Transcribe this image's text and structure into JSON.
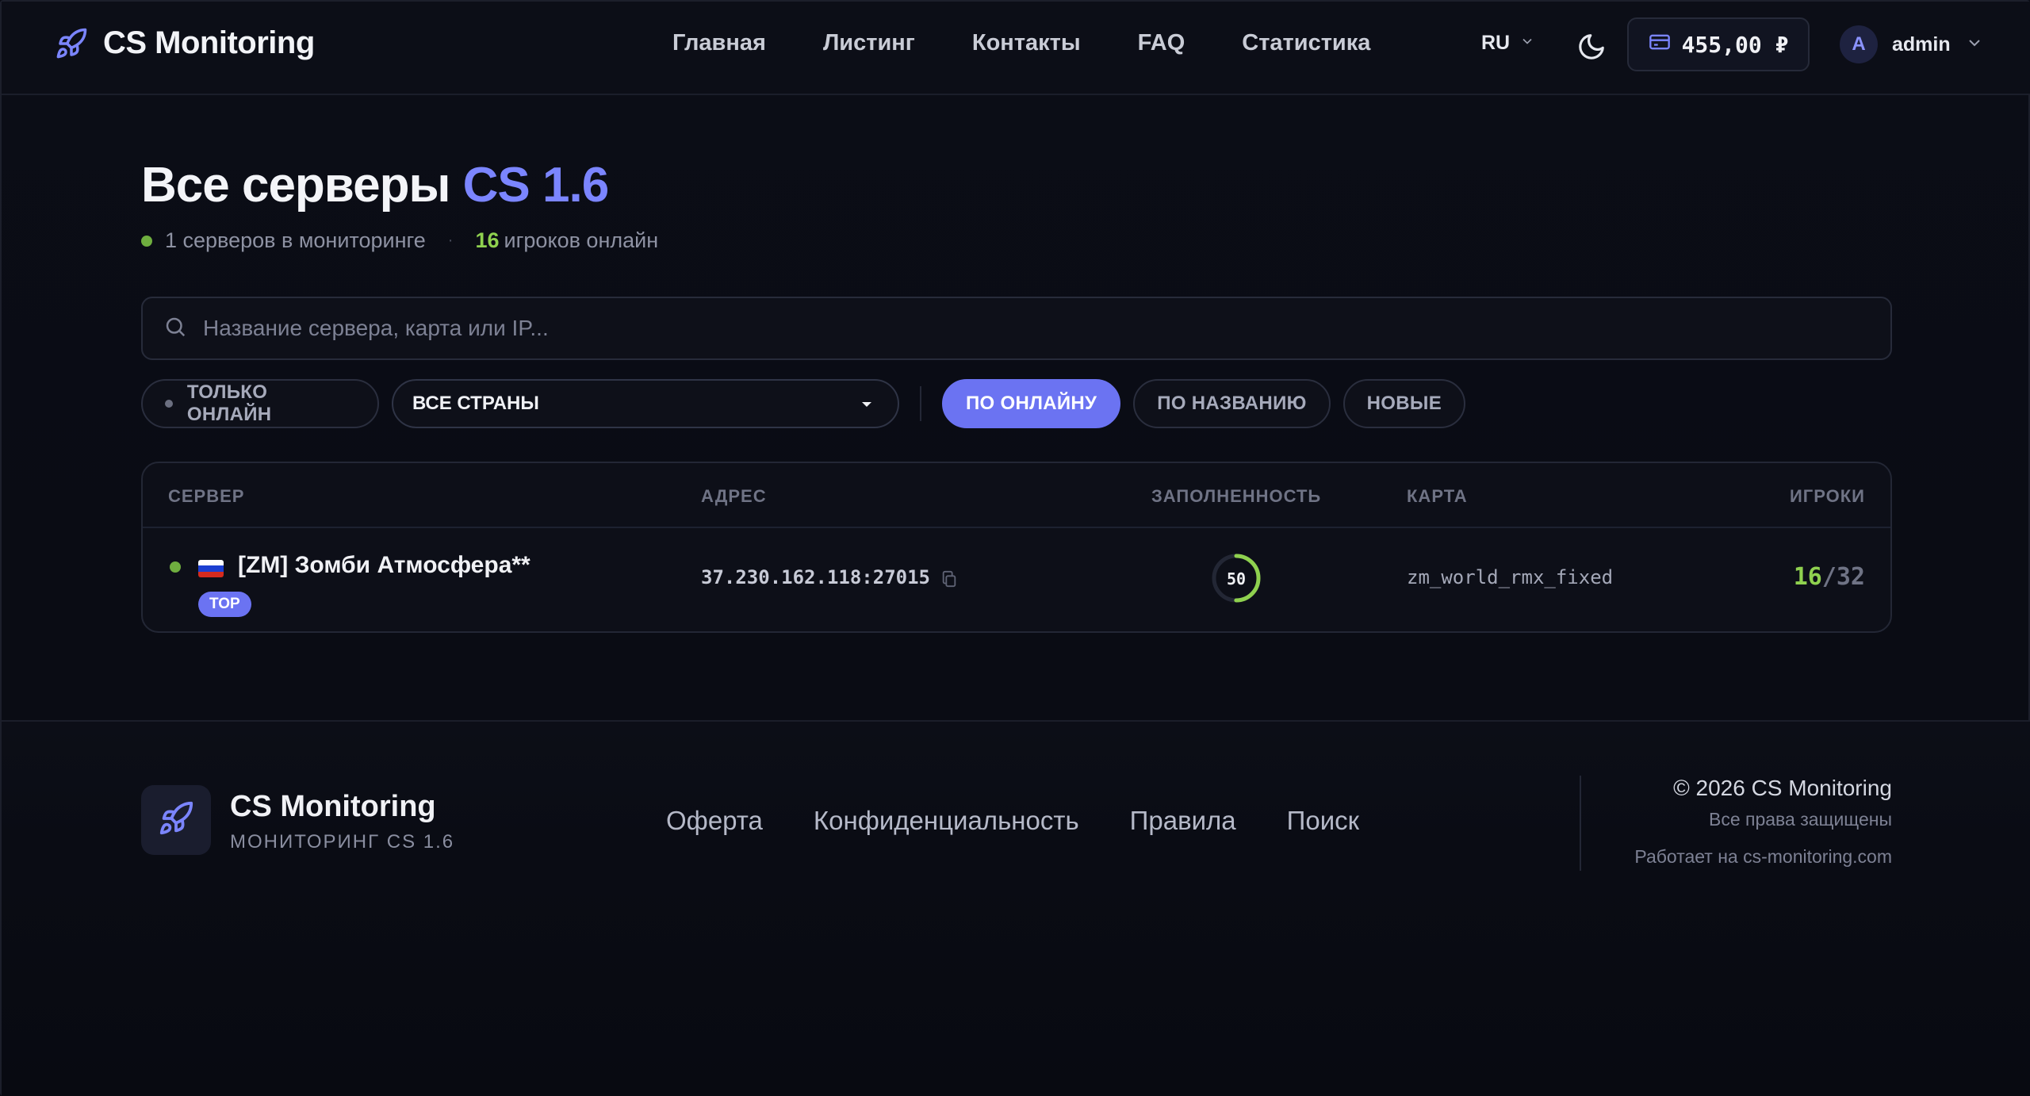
{
  "header": {
    "brand": "CS Monitoring",
    "nav": [
      "Главная",
      "Листинг",
      "Контакты",
      "FAQ",
      "Статистика"
    ],
    "lang": "RU",
    "balance": "455,00 ₽",
    "avatar_letter": "A",
    "username": "admin"
  },
  "main": {
    "title": "Все серверы",
    "title_accent": "CS 1.6",
    "servers_text": "1 серверов в мониторинге",
    "players_count": "16",
    "players_text": "игроков онлайн",
    "search_placeholder": "Название сервера, карта или IP...",
    "filters": {
      "online_only": "ТОЛЬКО ОНЛАЙН",
      "countries": "ВСЕ СТРАНЫ",
      "sort_online": "ПО ОНЛАЙНУ",
      "sort_name": "ПО НАЗВАНИЮ",
      "sort_new": "НОВЫЕ"
    }
  },
  "table": {
    "headers": {
      "server": "СЕРВЕР",
      "address": "АДРЕС",
      "fill": "ЗАПОЛНЕННОСТЬ",
      "map": "КАРТА",
      "players": "ИГРОКИ"
    },
    "rows": [
      {
        "name": "[ZM] Зомби Атмосфера**",
        "badge": "TOP",
        "address": "37.230.162.118:27015",
        "fill": "50",
        "fill_fraction": 0.5,
        "map": "zm_world_rmx_fixed",
        "players_online": "16",
        "players_max": "/32",
        "flag": "russia-flag",
        "status": "online"
      }
    ]
  },
  "footer": {
    "brand": "CS Monitoring",
    "subtitle": "МОНИТОРИНГ CS 1.6",
    "links": [
      "Оферта",
      "Конфиденциальность",
      "Правила",
      "Поиск"
    ],
    "copyright": "© 2026 CS Monitoring",
    "rights": "Все права защищены",
    "powered": "Работает на cs-monitoring.com"
  },
  "colors": {
    "accent": "#7b85ff",
    "online_green": "#8fd14f",
    "background": "#0a0c14"
  }
}
